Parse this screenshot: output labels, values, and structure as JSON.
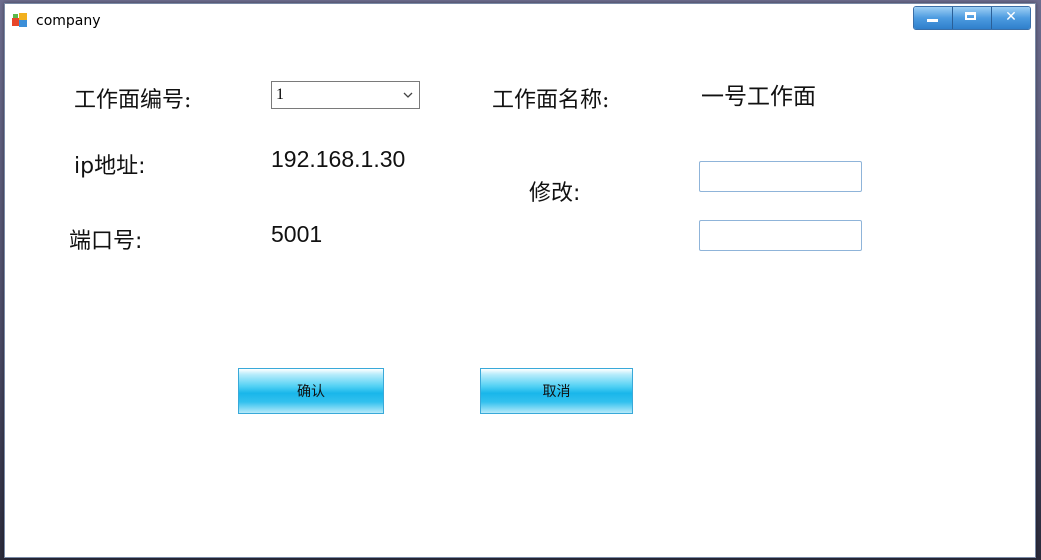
{
  "window": {
    "title": "company"
  },
  "form": {
    "workface_no_label": "工作面编号:",
    "workface_no_value": "1",
    "workface_name_label": "工作面名称:",
    "workface_name_value": "一号工作面",
    "ip_label": "ip地址:",
    "ip_value": "192.168.1.30",
    "port_label": "端口号:",
    "port_value": "5001",
    "modify_label": "修改:",
    "ip_input_value": "",
    "port_input_value": ""
  },
  "buttons": {
    "confirm": "确认",
    "cancel": "取消"
  },
  "colors": {
    "button_accent": "#19b6ea",
    "titlebar_buttons": "#4c9be0",
    "textbox_border": "#8fb4d9"
  },
  "icons": {
    "app": "windows-app-icon",
    "minimize": "minimize-icon",
    "maximize": "maximize-icon",
    "close": "close-icon",
    "dropdown": "chevron-down-icon"
  }
}
